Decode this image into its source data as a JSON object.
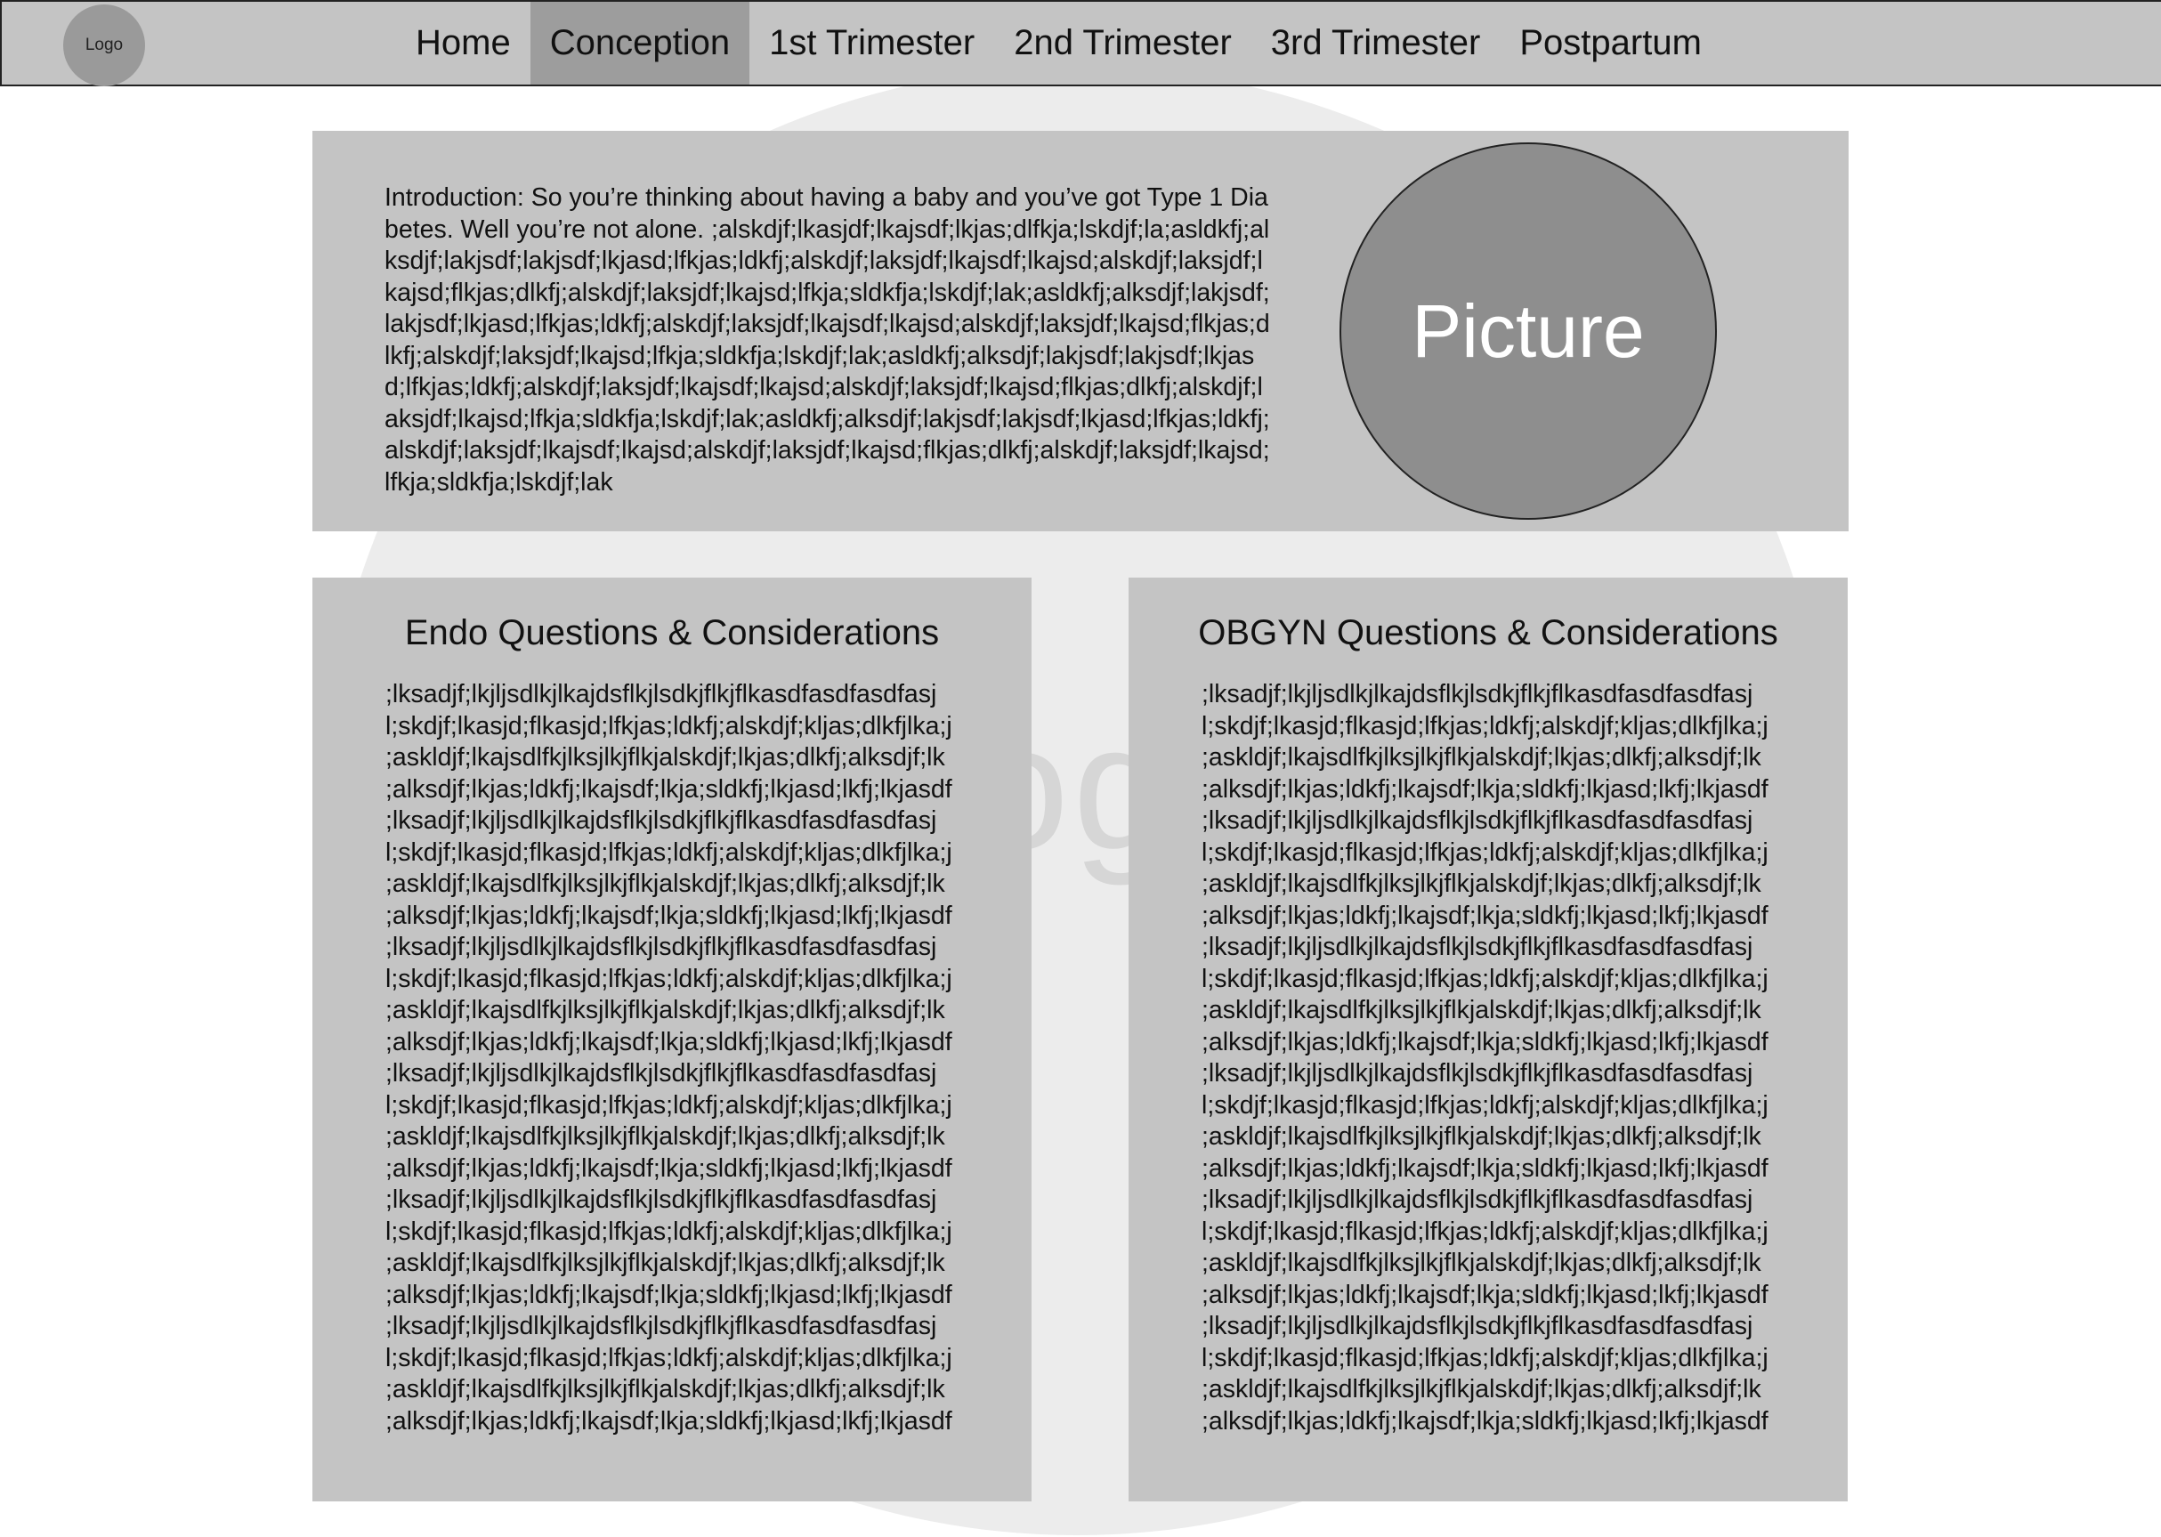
{
  "nav": {
    "logo_label": "Logo",
    "items": [
      {
        "label": "Home"
      },
      {
        "label": "Conception"
      },
      {
        "label": "1st Trimester"
      },
      {
        "label": "2nd Trimester"
      },
      {
        "label": "3rd Trimester"
      },
      {
        "label": "Postpartum"
      }
    ],
    "active": "Conception"
  },
  "background": {
    "watermark": "og"
  },
  "intro": {
    "text": "Introduction: So you’re thinking about having a baby and you’ve got Type 1 Diabetes.  Well you’re not alone.  ;alskdjf;lkasjdf;lkajsdf;lkjas;dlfkja;lskdjf;la;asldkfj;alksdjf;lakjsdf;lakjsdf;lkjasd;lfkjas;ldkfj;alskdjf;laksjdf;lkajsdf;lkajsd;alskdjf;laksjdf;lkajsd;flkjas;dlkfj;alskdjf;laksjdf;lkajsd;lfkja;sldkfja;lskdjf;lak;asldkfj;alksdjf;lakjsdf;lakjsdf;lkjasd;lfkjas;ldkfj;alskdjf;laksjdf;lkajsdf;lkajsd;alskdjf;laksjdf;lkajsd;flkjas;dlkfj;alskdjf;laksjdf;lkajsd;lfkja;sldkfja;lskdjf;lak;asldkfj;alksdjf;lakjsdf;lakjsdf;lkjasd;lfkjas;ldkfj;alskdjf;laksjdf;lkajsdf;lkajsd;alskdjf;laksjdf;lkajsd;flkjas;dlkfj;alskdjf;laksjdf;lkajsd;lfkja;sldkfja;lskdjf;lak;asldkfj;alksdjf;lakjsdf;lakjsdf;lkjasd;lfkjas;ldkfj;alskdjf;laksjdf;lkajsdf;lkajsd;alskdjf;laksjdf;lkajsd;flkjas;dlkfj;alskdjf;laksjdf;lkajsd;lfkja;sldkfja;lskdjf;lak",
    "picture_label": "Picture"
  },
  "endo": {
    "title": "Endo Questions & Considerations",
    "items": [
      ";lksadjf;lkjljsdlkjlkajdsflkjlsdkjflkjflkasdfasdfasdfasj",
      "l;skdjf;lkasjd;flkasjd;lfkjas;ldkfj;alskdjf;kljas;dlkfjlka;j",
      ";askldjf;lkajsdlfkjlksjlkjflkjalskdjf;lkjas;dlkfj;alksdjf;lk",
      ";alksdjf;lkjas;ldkfj;lkajsdf;lkja;sldkfj;lkjasd;lkfj;lkjasdf",
      ";lksadjf;lkjljsdlkjlkajdsflkjlsdkjflkjflkasdfasdfasdfasj",
      "l;skdjf;lkasjd;flkasjd;lfkjas;ldkfj;alskdjf;kljas;dlkfjlka;j",
      ";askldjf;lkajsdlfkjlksjlkjflkjalskdjf;lkjas;dlkfj;alksdjf;lk",
      ";alksdjf;lkjas;ldkfj;lkajsdf;lkja;sldkfj;lkjasd;lkfj;lkjasdf",
      ";lksadjf;lkjljsdlkjlkajdsflkjlsdkjflkjflkasdfasdfasdfasj",
      "l;skdjf;lkasjd;flkasjd;lfkjas;ldkfj;alskdjf;kljas;dlkfjlka;j",
      ";askldjf;lkajsdlfkjlksjlkjflkjalskdjf;lkjas;dlkfj;alksdjf;lk",
      ";alksdjf;lkjas;ldkfj;lkajsdf;lkja;sldkfj;lkjasd;lkfj;lkjasdf",
      ";lksadjf;lkjljsdlkjlkajdsflkjlsdkjflkjflkasdfasdfasdfasj",
      "l;skdjf;lkasjd;flkasjd;lfkjas;ldkfj;alskdjf;kljas;dlkfjlka;j",
      ";askldjf;lkajsdlfkjlksjlkjflkjalskdjf;lkjas;dlkfj;alksdjf;lk",
      ";alksdjf;lkjas;ldkfj;lkajsdf;lkja;sldkfj;lkjasd;lkfj;lkjasdf",
      ";lksadjf;lkjljsdlkjlkajdsflkjlsdkjflkjflkasdfasdfasdfasj",
      "l;skdjf;lkasjd;flkasjd;lfkjas;ldkfj;alskdjf;kljas;dlkfjlka;j",
      ";askldjf;lkajsdlfkjlksjlkjflkjalskdjf;lkjas;dlkfj;alksdjf;lk",
      ";alksdjf;lkjas;ldkfj;lkajsdf;lkja;sldkfj;lkjasd;lkfj;lkjasdf",
      ";lksadjf;lkjljsdlkjlkajdsflkjlsdkjflkjflkasdfasdfasdfasj",
      "l;skdjf;lkasjd;flkasjd;lfkjas;ldkfj;alskdjf;kljas;dlkfjlka;j",
      ";askldjf;lkajsdlfkjlksjlkjflkjalskdjf;lkjas;dlkfj;alksdjf;lk",
      ";alksdjf;lkjas;ldkfj;lkajsdf;lkja;sldkfj;lkjasd;lkfj;lkjasdf"
    ]
  },
  "obgyn": {
    "title": "OBGYN Questions & Considerations",
    "items": [
      ";lksadjf;lkjljsdlkjlkajdsflkjlsdkjflkjflkasdfasdfasdfasj",
      "l;skdjf;lkasjd;flkasjd;lfkjas;ldkfj;alskdjf;kljas;dlkfjlka;j",
      ";askldjf;lkajsdlfkjlksjlkjflkjalskdjf;lkjas;dlkfj;alksdjf;lk",
      ";alksdjf;lkjas;ldkfj;lkajsdf;lkja;sldkfj;lkjasd;lkfj;lkjasdf",
      ";lksadjf;lkjljsdlkjlkajdsflkjlsdkjflkjflkasdfasdfasdfasj",
      "l;skdjf;lkasjd;flkasjd;lfkjas;ldkfj;alskdjf;kljas;dlkfjlka;j",
      ";askldjf;lkajsdlfkjlksjlkjflkjalskdjf;lkjas;dlkfj;alksdjf;lk",
      ";alksdjf;lkjas;ldkfj;lkajsdf;lkja;sldkfj;lkjasd;lkfj;lkjasdf",
      ";lksadjf;lkjljsdlkjlkajdsflkjlsdkjflkjflkasdfasdfasdfasj",
      "l;skdjf;lkasjd;flkasjd;lfkjas;ldkfj;alskdjf;kljas;dlkfjlka;j",
      ";askldjf;lkajsdlfkjlksjlkjflkjalskdjf;lkjas;dlkfj;alksdjf;lk",
      ";alksdjf;lkjas;ldkfj;lkajsdf;lkja;sldkfj;lkjasd;lkfj;lkjasdf",
      ";lksadjf;lkjljsdlkjlkajdsflkjlsdkjflkjflkasdfasdfasdfasj",
      "l;skdjf;lkasjd;flkasjd;lfkjas;ldkfj;alskdjf;kljas;dlkfjlka;j",
      ";askldjf;lkajsdlfkjlksjlkjflkjalskdjf;lkjas;dlkfj;alksdjf;lk",
      ";alksdjf;lkjas;ldkfj;lkajsdf;lkja;sldkfj;lkjasd;lkfj;lkjasdf",
      ";lksadjf;lkjljsdlkjlkajdsflkjlsdkjflkjflkasdfasdfasdfasj",
      "l;skdjf;lkasjd;flkasjd;lfkjas;ldkfj;alskdjf;kljas;dlkfjlka;j",
      ";askldjf;lkajsdlfkjlksjlkjflkjalskdjf;lkjas;dlkfj;alksdjf;lk",
      ";alksdjf;lkjas;ldkfj;lkajsdf;lkja;sldkfj;lkjasd;lkfj;lkjasdf",
      ";lksadjf;lkjljsdlkjlkajdsflkjlsdkjflkjflkasdfasdfasdfasj",
      "l;skdjf;lkasjd;flkasjd;lfkjas;ldkfj;alskdjf;kljas;dlkfjlka;j",
      ";askldjf;lkajsdlfkjlksjlkjflkjalskdjf;lkjas;dlkfj;alksdjf;lk",
      ";alksdjf;lkjas;ldkfj;lkajsdf;lkja;sldkfj;lkjasd;lkfj;lkjasdf"
    ]
  },
  "colors": {
    "nav_bg": "#c4c4c4",
    "nav_active_bg": "#9d9d9d",
    "card_bg": "#c4c4c4",
    "picture_bg": "#8e8e8e",
    "background_circle": "#ececec"
  }
}
